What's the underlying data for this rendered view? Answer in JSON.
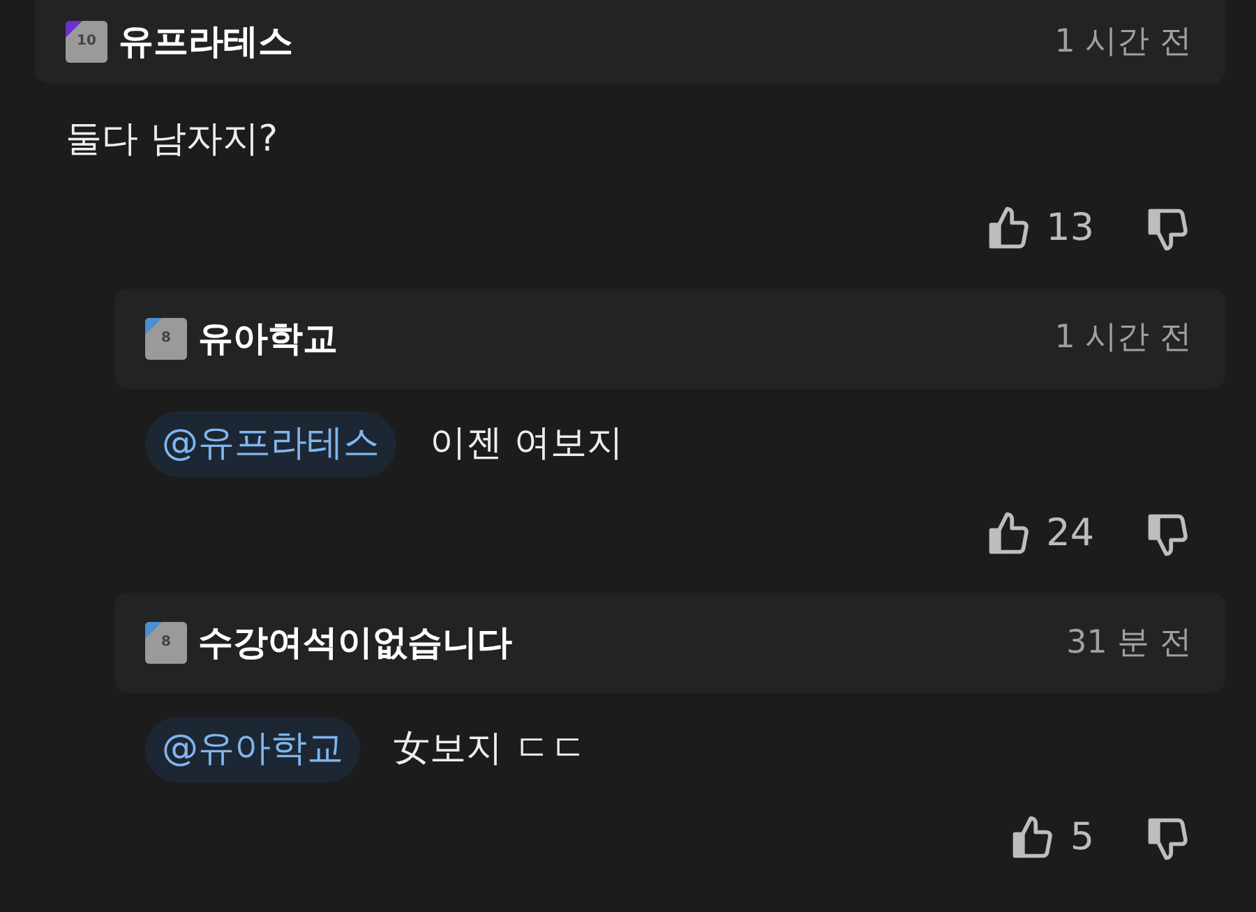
{
  "comments": [
    {
      "author": "유프라테스",
      "level_badge": "10",
      "color": "#6a2fd0",
      "time": "1 시간 전",
      "reply": false,
      "text": "둘다 남자지?",
      "likes": "13"
    },
    {
      "author": "유아학교",
      "level_badge": "8",
      "color": "#4a90d0",
      "time": "1 시간 전",
      "reply": true,
      "mention": "@유프라테스",
      "text": "이젠 여보지",
      "likes": "24"
    },
    {
      "author": "수강여석이없습니다",
      "level_badge": "8",
      "color": "#4a90d0",
      "time": "31 분 전",
      "reply": true,
      "mention": "@유아학교",
      "text": "女보지 ㄷㄷ",
      "likes": "5"
    }
  ]
}
